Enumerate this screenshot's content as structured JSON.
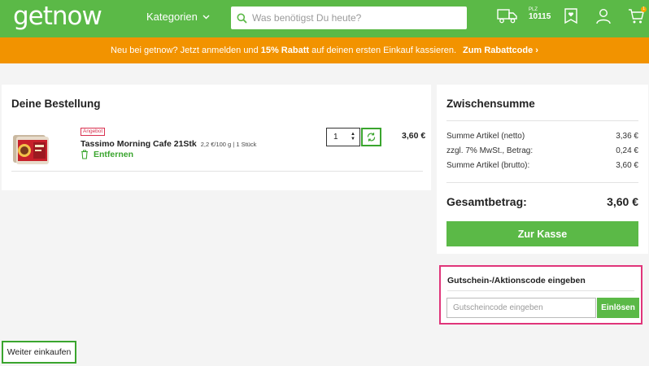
{
  "header": {
    "logo": "getnow",
    "categories_label": "Kategorien",
    "search_placeholder": "Was benötigst Du heute?",
    "plz_label": "PLZ",
    "plz_value": "10115",
    "cart_count": "1"
  },
  "promo": {
    "text_before": "Neu bei getnow? Jetzt anmelden und ",
    "text_bold": "15% Rabatt",
    "text_after": " auf deinen ersten Einkauf kassieren.",
    "link": "Zum Rabattcode ›"
  },
  "order": {
    "title": "Deine Bestellung",
    "item": {
      "badge": "Angebot",
      "name": "Tassimo Morning Cafe 21Stk",
      "details": "2,2 €/100 g | 1 Stück",
      "remove_label": "Entfernen",
      "quantity": "1",
      "price": "3,60 €"
    }
  },
  "summary": {
    "title": "Zwischensumme",
    "rows": [
      {
        "label": "Summe Artikel (netto)",
        "value": "3,36 €"
      },
      {
        "label": "zzgl. 7% MwSt., Betrag:",
        "value": "0,24 €"
      },
      {
        "label": "Summe Artikel (brutto):",
        "value": "3,60 €"
      }
    ],
    "total_label": "Gesamtbetrag:",
    "total_value": "3,60 €",
    "checkout_label": "Zur Kasse"
  },
  "coupon": {
    "title": "Gutschein-/Aktionscode eingeben",
    "placeholder": "Gutscheincode eingeben",
    "button": "Einlösen"
  },
  "continue_label": "Weiter einkaufen",
  "colors": {
    "brand_green": "#5bb947",
    "promo_orange": "#f29300",
    "highlight_pink": "#e0357a",
    "offer_red": "#d9304f"
  }
}
